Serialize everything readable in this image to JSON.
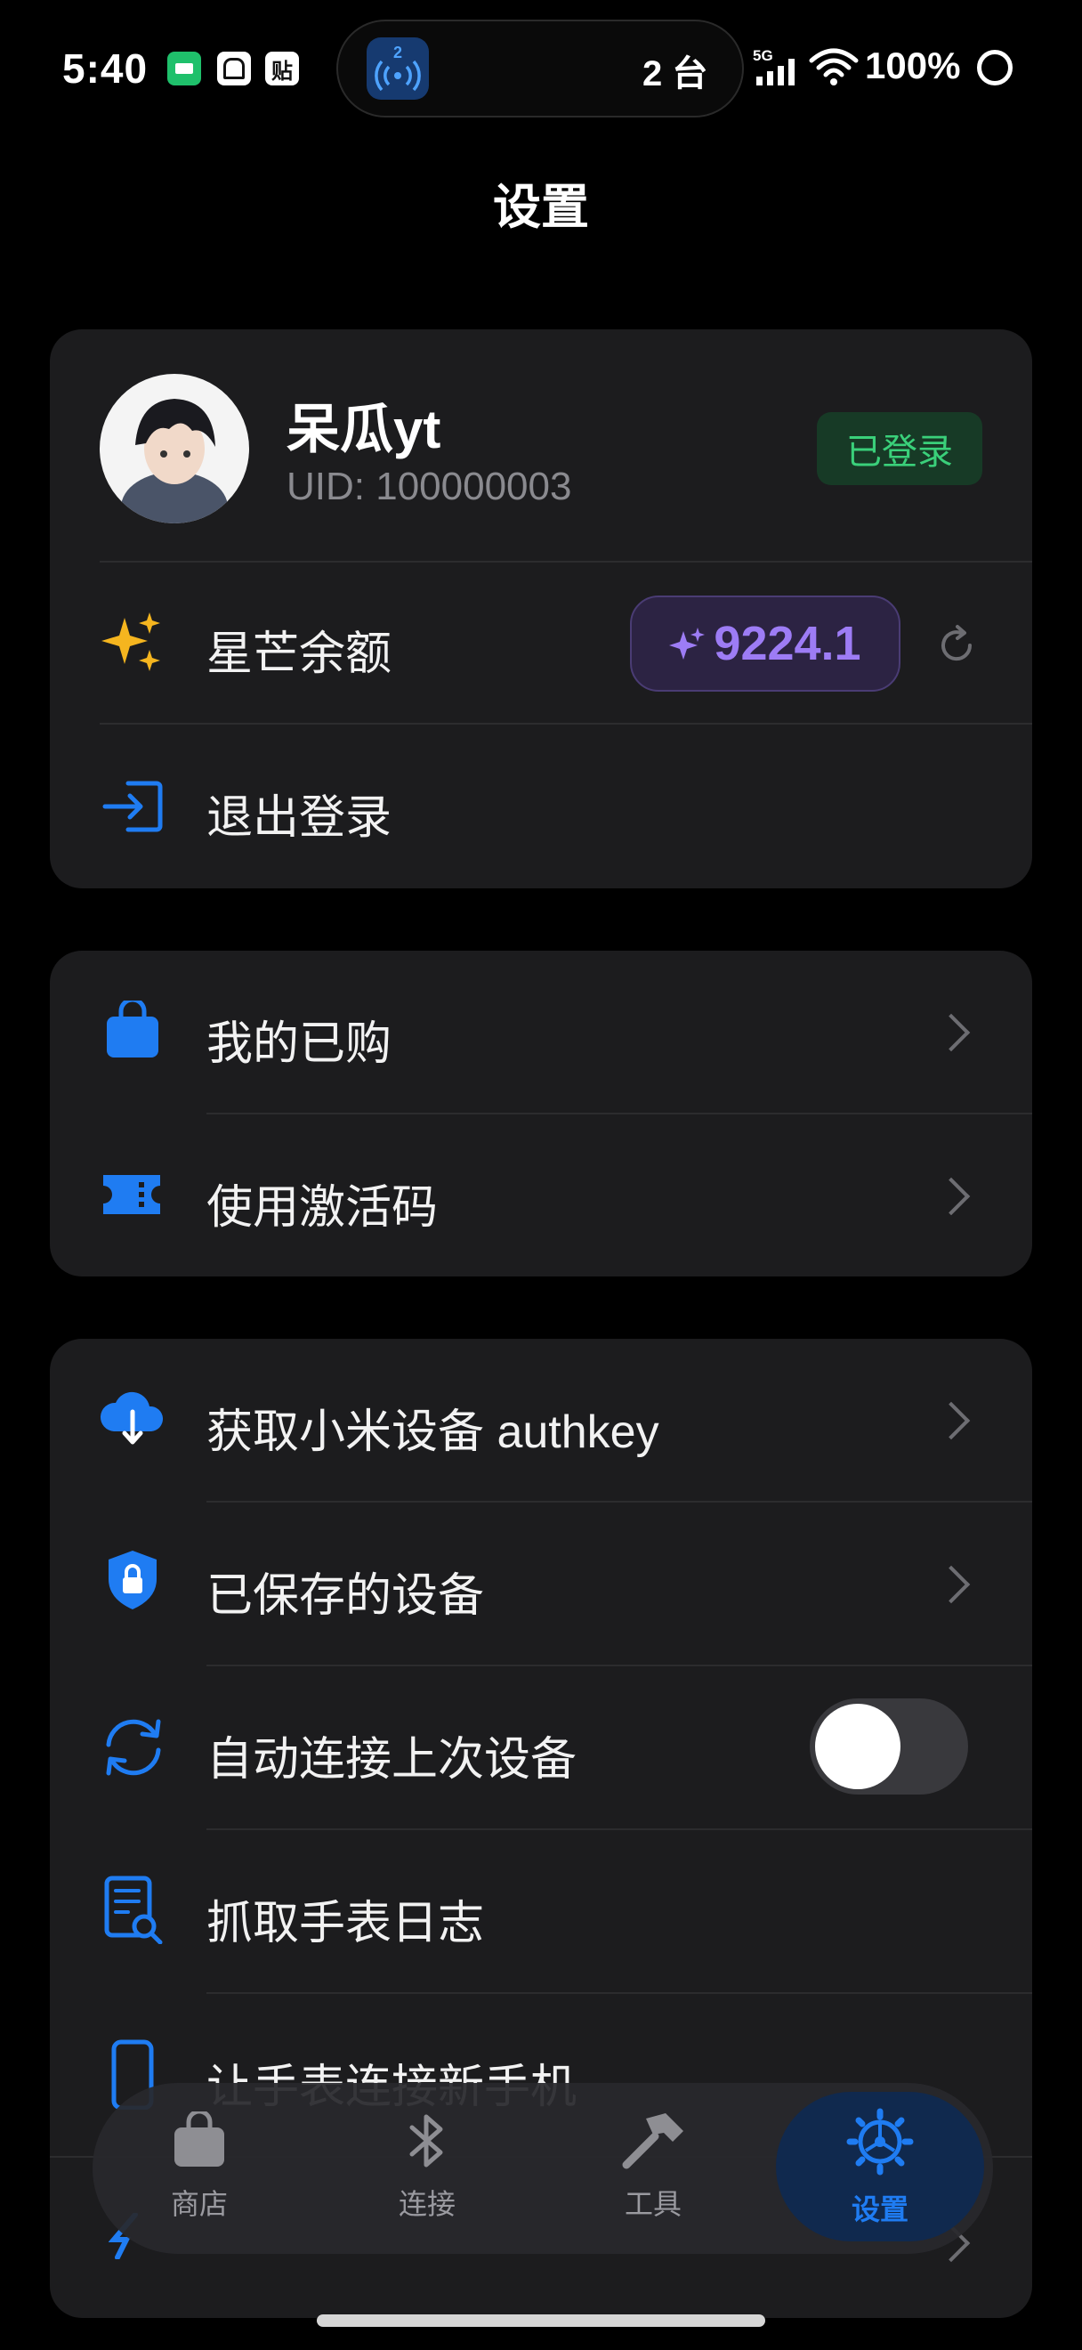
{
  "status_bar": {
    "time": "5:40",
    "app_icon_3_text": "贴",
    "island_badge_number": "2",
    "device_count": "2 台",
    "network": "5G",
    "battery": "100%"
  },
  "page_title": "设置",
  "account": {
    "username": "呆瓜yt",
    "uid": "UID: 100000003",
    "login_badge": "已登录",
    "balance_label": "星芒余额",
    "balance_value": "9224.1",
    "logout_label": "退出登录"
  },
  "purchase": {
    "items": [
      {
        "label": "我的已购",
        "icon": "shopping-bag-icon"
      },
      {
        "label": "使用激活码",
        "icon": "ticket-icon"
      }
    ]
  },
  "device": {
    "items": [
      {
        "label": "获取小米设备 authkey",
        "icon": "cloud-download-icon"
      },
      {
        "label": "已保存的设备",
        "icon": "shield-lock-icon"
      },
      {
        "label": "自动连接上次设备",
        "icon": "sync-icon",
        "toggle": "off"
      },
      {
        "label": "抓取手表日志",
        "icon": "document-search-icon"
      },
      {
        "label": "让手表连接新手机",
        "icon": "phone-icon"
      }
    ]
  },
  "tabs": [
    {
      "label": "商店",
      "icon": "bag-icon",
      "active": false
    },
    {
      "label": "连接",
      "icon": "bluetooth-icon",
      "active": false
    },
    {
      "label": "工具",
      "icon": "hammer-icon",
      "active": false
    },
    {
      "label": "设置",
      "icon": "gear-icon",
      "active": true
    }
  ],
  "colors": {
    "background": "#000000",
    "card": "#1c1c1e",
    "accent_blue": "#1f7cf2",
    "success_green": "#3ad07a",
    "balance_purple": "#9d7cf5",
    "star_yellow": "#f5b51f"
  }
}
